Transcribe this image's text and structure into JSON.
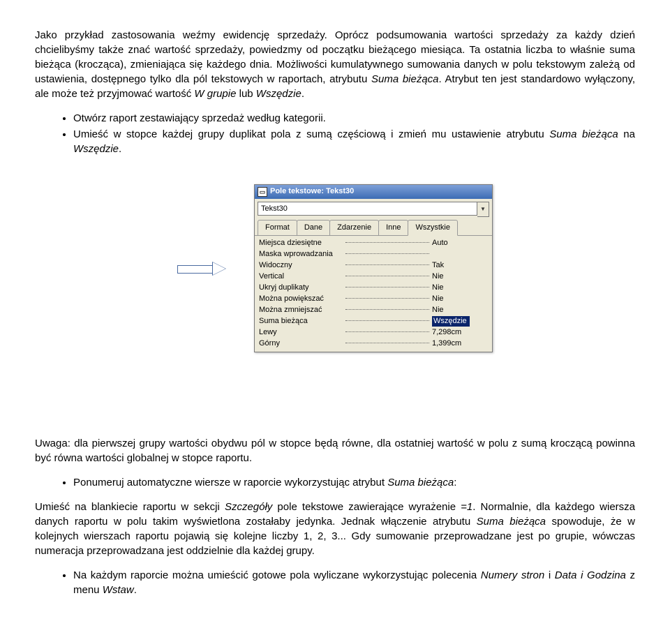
{
  "p1_part1": "Jako przykład zastosowania weźmy ewidencję sprzedaży. Oprócz podsumowania wartości sprzedaży za każdy dzień chcielibyśmy także znać wartość sprzedaży, powiedzmy od początku bieżącego miesiąca. Ta ostatnia liczba to właśnie suma bieżąca (krocząca), zmieniająca się każdego dnia. Możliwości kumulatywnego sumowania danych w polu tekstowym zależą od ustawienia, dostępnego tylko dla pól tekstowych w raportach, atrybutu ",
  "p1_attr": "Suma bieżąca",
  "p1_part2": ". Atrybut ten jest standardowo wyłączony, ale może też przyjmować wartość ",
  "p1_val1": "W grupie",
  "p1_part3": " lub ",
  "p1_val2": "Wszędzie",
  "p1_part4": ".",
  "b1": "Otwórz raport zestawiający sprzedaż według kategorii.",
  "b2_part1": "Umieść w stopce każdej grupy duplikat pola z sumą częściową i zmień mu ustawienie atrybutu ",
  "b2_attr": "Suma bieżąca",
  "b2_part2": " na ",
  "b2_val": "Wszędzie",
  "b2_part3": ".",
  "propwin": {
    "title": "Pole tekstowe: Tekst30",
    "combo_value": "Tekst30",
    "tabs": {
      "t1": "Format",
      "t2": "Dane",
      "t3": "Zdarzenie",
      "t4": "Inne",
      "t5": "Wszystkie"
    },
    "rows": {
      "r0": {
        "label": "Miejsca dziesiętne",
        "value": "Auto"
      },
      "r1": {
        "label": "Maska wprowadzania",
        "value": ""
      },
      "r2": {
        "label": "Widoczny",
        "value": "Tak"
      },
      "r3": {
        "label": "Vertical",
        "value": "Nie"
      },
      "r4": {
        "label": "Ukryj duplikaty",
        "value": "Nie"
      },
      "r5": {
        "label": "Można powiększać",
        "value": "Nie"
      },
      "r6": {
        "label": "Można zmniejszać",
        "value": "Nie"
      },
      "r7": {
        "label": "Suma bieżąca",
        "value": "Wszędzie"
      },
      "r8": {
        "label": "Lewy",
        "value": "7,298cm"
      },
      "r9": {
        "label": "Górny",
        "value": "1,399cm"
      }
    }
  },
  "p3": "Uwaga: dla pierwszej grupy wartości obydwu pól w stopce będą równe, dla ostatniej wartość w polu z sumą kroczącą powinna być równa wartości globalnej w stopce raportu.",
  "b3_part1": "Ponumeruj automatyczne wiersze w raporcie wykorzystując atrybut ",
  "b3_attr": "Suma bieżąca",
  "b3_part2": ":",
  "p4_part1": "Umieść na blankiecie raportu w sekcji ",
  "p4_it1": "Szczegóły",
  "p4_part2": " pole tekstowe zawierające wyrażenie ",
  "p4_it2": "=1",
  "p4_part3": ". Normalnie, dla każdego wiersza danych raportu w polu takim wyświetlona zostałaby jedynka. Jednak włączenie atrybutu ",
  "p4_it3": "Suma bieżąca",
  "p4_part4": " spowoduje, że w kolejnych wierszach raportu pojawią się kolejne liczby 1, 2, 3... Gdy sumowanie przeprowadzane jest po grupie, wówczas numeracja przeprowadzana jest oddzielnie dla każdej grupy.",
  "b4_part1": "Na każdym raporcie można umieścić gotowe pola wyliczane wykorzystując polecenia ",
  "b4_it1": "Numery stron",
  "b4_part2": " i ",
  "b4_it2": "Data i Godzina",
  "b4_part3": " z menu ",
  "b4_it3": "Wstaw",
  "b4_part4": "."
}
